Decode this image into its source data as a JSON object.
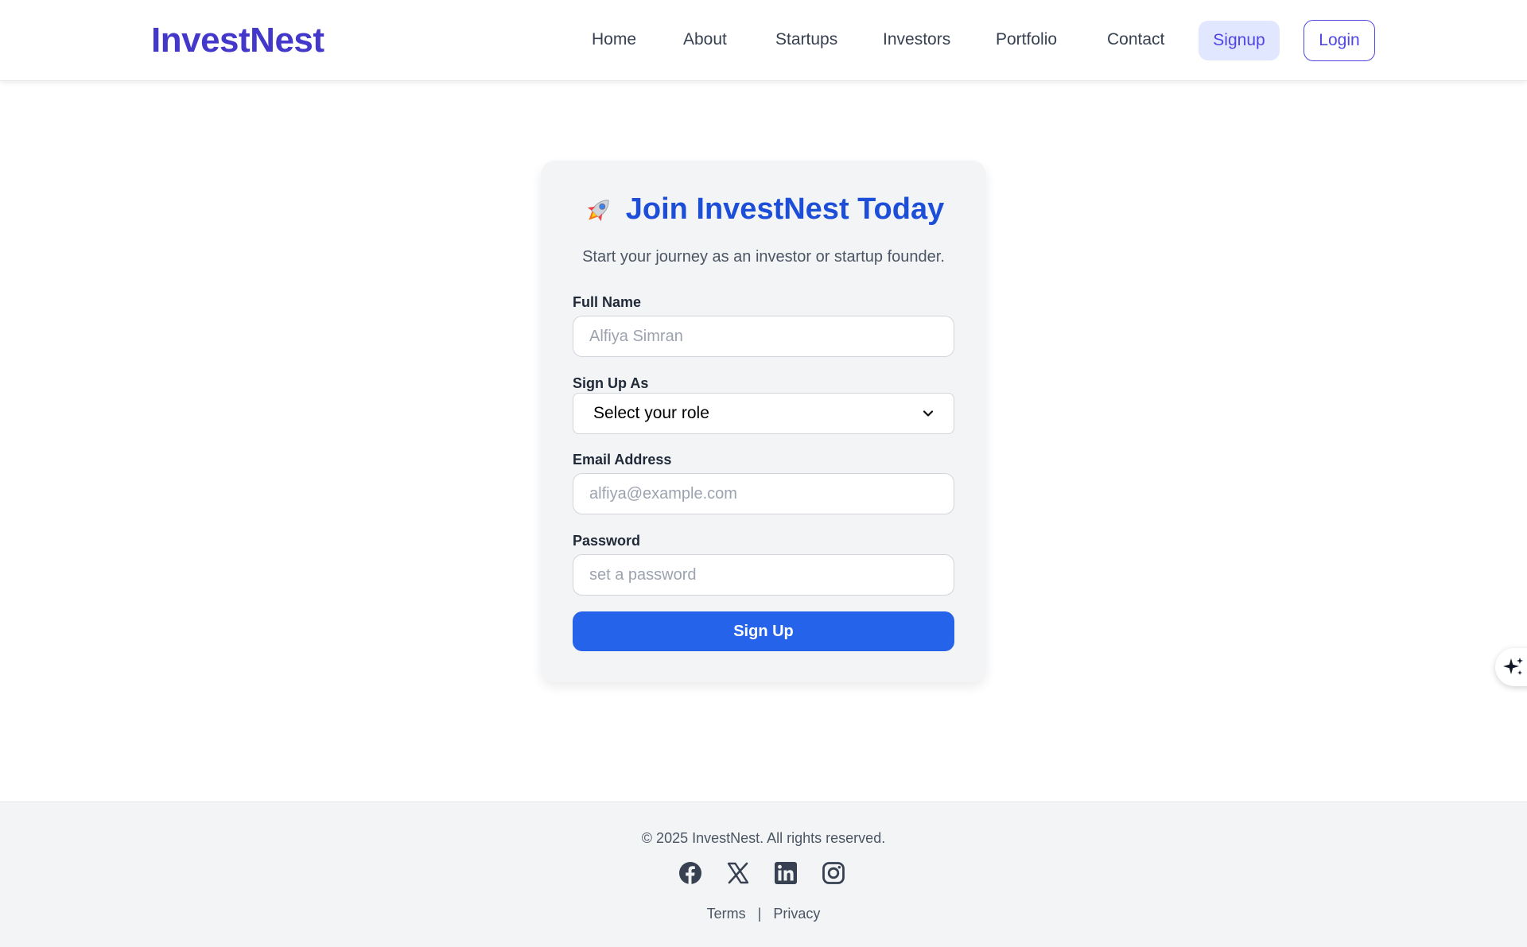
{
  "brand": {
    "logo": "InvestNest"
  },
  "nav": {
    "items": [
      {
        "label": "Home"
      },
      {
        "label": "About"
      },
      {
        "label": "Startups"
      },
      {
        "label": "Investors"
      },
      {
        "label": "Portfolio"
      },
      {
        "label": "Contact"
      }
    ],
    "signup_label": "Signup",
    "login_label": "Login"
  },
  "form": {
    "icon": "rocket-icon",
    "title": "Join InvestNest Today",
    "subtitle": "Start your journey as an investor or startup founder.",
    "full_name": {
      "label": "Full Name",
      "placeholder": "Alfiya Simran"
    },
    "role": {
      "label": "Sign Up As",
      "selected": "Select your role"
    },
    "email": {
      "label": "Email Address",
      "placeholder": "alfiya@example.com"
    },
    "password": {
      "label": "Password",
      "placeholder": "set a password"
    },
    "submit_label": "Sign Up"
  },
  "assist": {
    "icon": "sparkles-icon"
  },
  "footer": {
    "copyright": "© 2025 InvestNest. All rights reserved.",
    "social_icons": [
      "facebook-icon",
      "x-icon",
      "linkedin-icon",
      "instagram-icon"
    ],
    "links": {
      "terms": "Terms",
      "separator": "|",
      "privacy": "Privacy"
    }
  },
  "colors": {
    "brand": "#4338ca",
    "primary": "#2563eb",
    "title": "#1d4ed8",
    "signup_bg": "#e0e7ff",
    "card_bg": "#f3f4f6"
  }
}
